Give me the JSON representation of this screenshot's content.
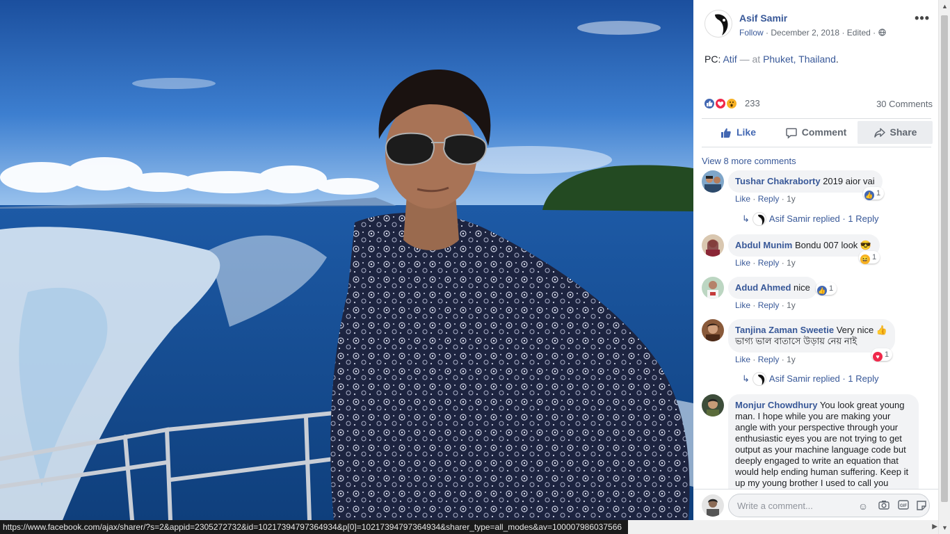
{
  "post": {
    "author": "Asif Samir",
    "follow": "Follow",
    "date": "December 2, 2018",
    "edited": "Edited",
    "sep": "·",
    "text_prefix": "PC: ",
    "tagged": "Atif",
    "at_text": " — at ",
    "place": "Phuket, Thailand",
    "period": ".",
    "reaction_count": "233",
    "comments_count": "30 Comments"
  },
  "actions": {
    "like": "Like",
    "comment": "Comment",
    "share": "Share"
  },
  "more_comments": "View 8 more comments",
  "comments": [
    {
      "name": "Tushar Chakraborty",
      "text": "2019 aior vai",
      "reaction_count": "1",
      "like": "Like",
      "reply": "Reply",
      "age": "1y",
      "replied_by": "Asif Samir",
      "replied_word": "replied",
      "reply_count": "1 Reply"
    },
    {
      "name": "Abdul Munim",
      "text": "Bondu 007 look 😎",
      "reaction_count": "1",
      "like": "Like",
      "reply": "Reply",
      "age": "1y"
    },
    {
      "name": "Adud Ahmed",
      "text": "nice",
      "reaction_count": "1",
      "like": "Like",
      "reply": "Reply",
      "age": "1y"
    },
    {
      "name": "Tanjina Zaman Sweetie",
      "text": "Very nice 👍",
      "text_line2": "ভাগ্য ভাল বাতাসে উড়ায় নেয় নাই",
      "reaction_count": "1",
      "like": "Like",
      "reply": "Reply",
      "age": "1y",
      "replied_by": "Asif Samir",
      "replied_word": "replied",
      "reply_count": "1 Reply"
    },
    {
      "name": "Monjur Chowdhury",
      "lines": [
        "You look great young",
        "man. I hope while you are making your",
        "angle with your perspective through your",
        "enthusiastic eyes you are not trying to get",
        "output as your machine language code but",
        "deeply engaged to write an equation that",
        "would help ending human suffering. Keep it",
        "up my young brother I used to call you"
      ]
    }
  ],
  "composer": {
    "placeholder": "Write a comment..."
  },
  "status_url": "https://www.facebook.com/ajax/sharer/?s=2&appid=2305272732&id=10217394797364934&p[0]=10217394797364934&sharer_type=all_modes&av=100007986037566",
  "colors": {
    "link": "#385898",
    "like_blue": "#4267b2",
    "heart_red": "#f0284a",
    "wow_yellow": "#f7b125"
  }
}
